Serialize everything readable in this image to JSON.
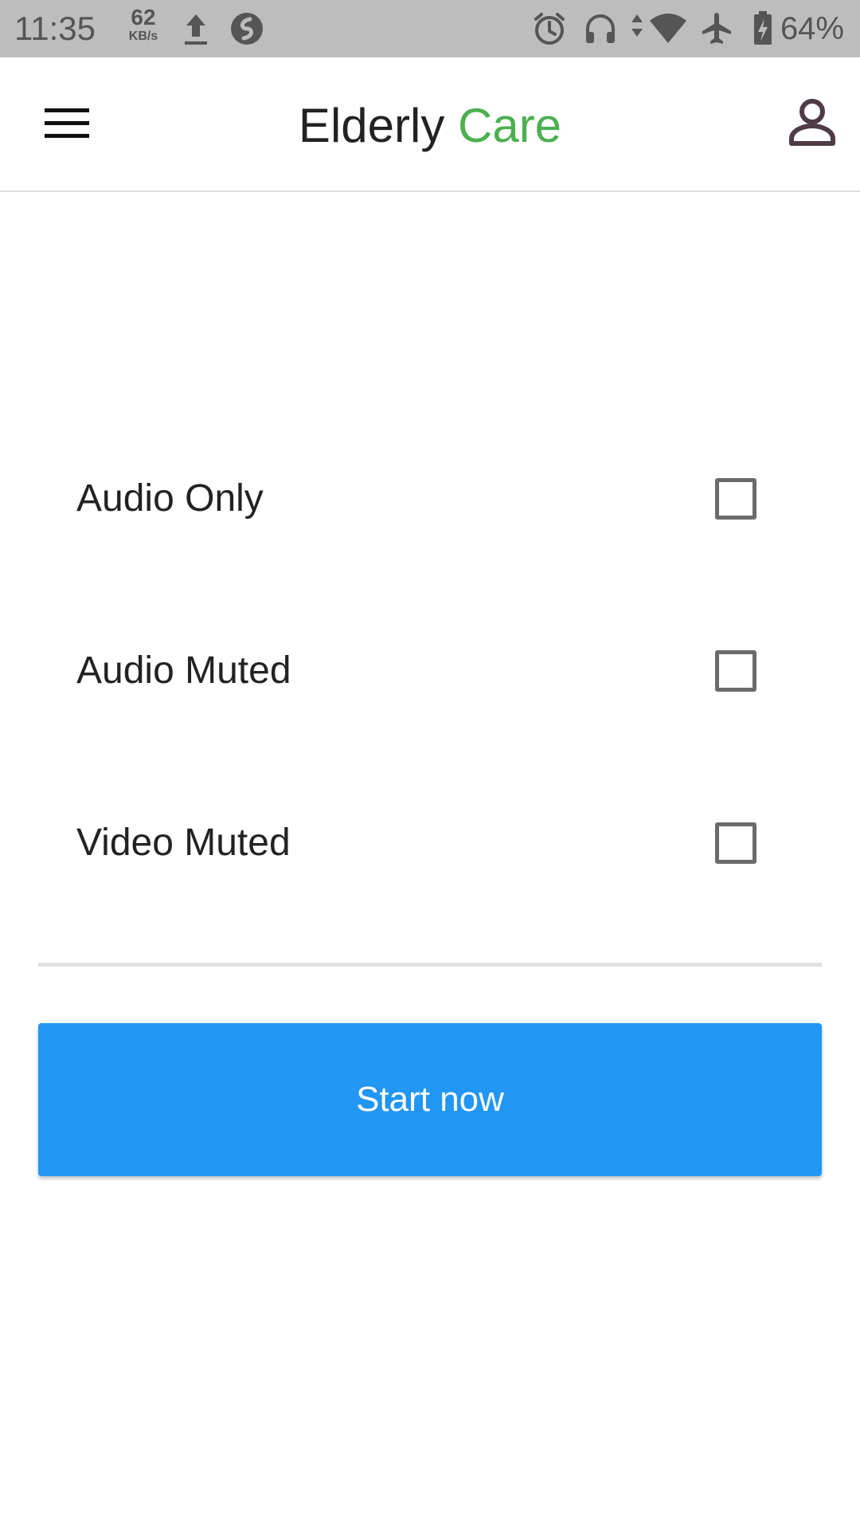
{
  "status_bar": {
    "time": "11:35",
    "net_speed_value": "62",
    "net_speed_unit": "KB/s",
    "battery_percent": "64%",
    "icons": [
      "upload-icon",
      "shazam-icon",
      "alarm-icon",
      "headset-icon",
      "data-arrows-icon",
      "wifi-icon",
      "airplane-icon",
      "battery-charging-icon"
    ]
  },
  "app_bar": {
    "title_main": "Elderly",
    "title_accent": "Care",
    "accent_color": "#4caf50",
    "menu_icon": "menu-icon",
    "profile_icon": "person-icon"
  },
  "options": [
    {
      "label": "Audio Only",
      "checked": false
    },
    {
      "label": "Audio Muted",
      "checked": false
    },
    {
      "label": "Video Muted",
      "checked": false
    }
  ],
  "start_button": {
    "label": "Start now",
    "color": "#2196f3"
  }
}
